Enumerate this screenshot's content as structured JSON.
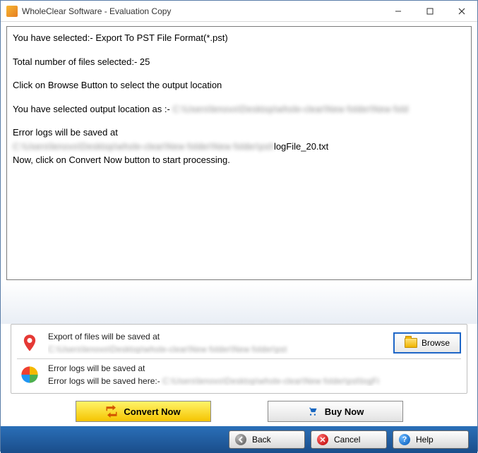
{
  "window": {
    "title": "WholeClear Software - Evaluation Copy"
  },
  "log": {
    "l1": "You have selected:- Export To PST File Format(*.pst)",
    "l2": "Total number of files selected:- 25",
    "l3": "Click on Browse Button to select the output location",
    "l4a": "You have selected output location as :- ",
    "l4b": "C:\\Users\\lenovo\\Desktop\\whole-clear\\New folder\\New fold",
    "l5": "Error logs will be saved at",
    "l6a": "C:\\Users\\lenovo\\Desktop\\whole-clear\\New folder\\New folder\\pst\\",
    "l6b": "logFile_20.txt",
    "l7": "Now, click on Convert Now button to start processing."
  },
  "panel": {
    "exportLabel": "Export of files will be saved at",
    "exportPath": "C:\\Users\\lenovo\\Desktop\\whole-clear\\New folder\\New folder\\pst",
    "errorLabel": "Error logs will be saved at",
    "errorPrefix": "Error logs will be saved here:- ",
    "errorPath": "C:\\Users\\lenovo\\Desktop\\whole-clear\\New folder\\pst\\logFi",
    "browse": "Browse"
  },
  "buttons": {
    "convert": "Convert Now",
    "buy": "Buy Now",
    "back": "Back",
    "cancel": "Cancel",
    "help": "Help"
  }
}
